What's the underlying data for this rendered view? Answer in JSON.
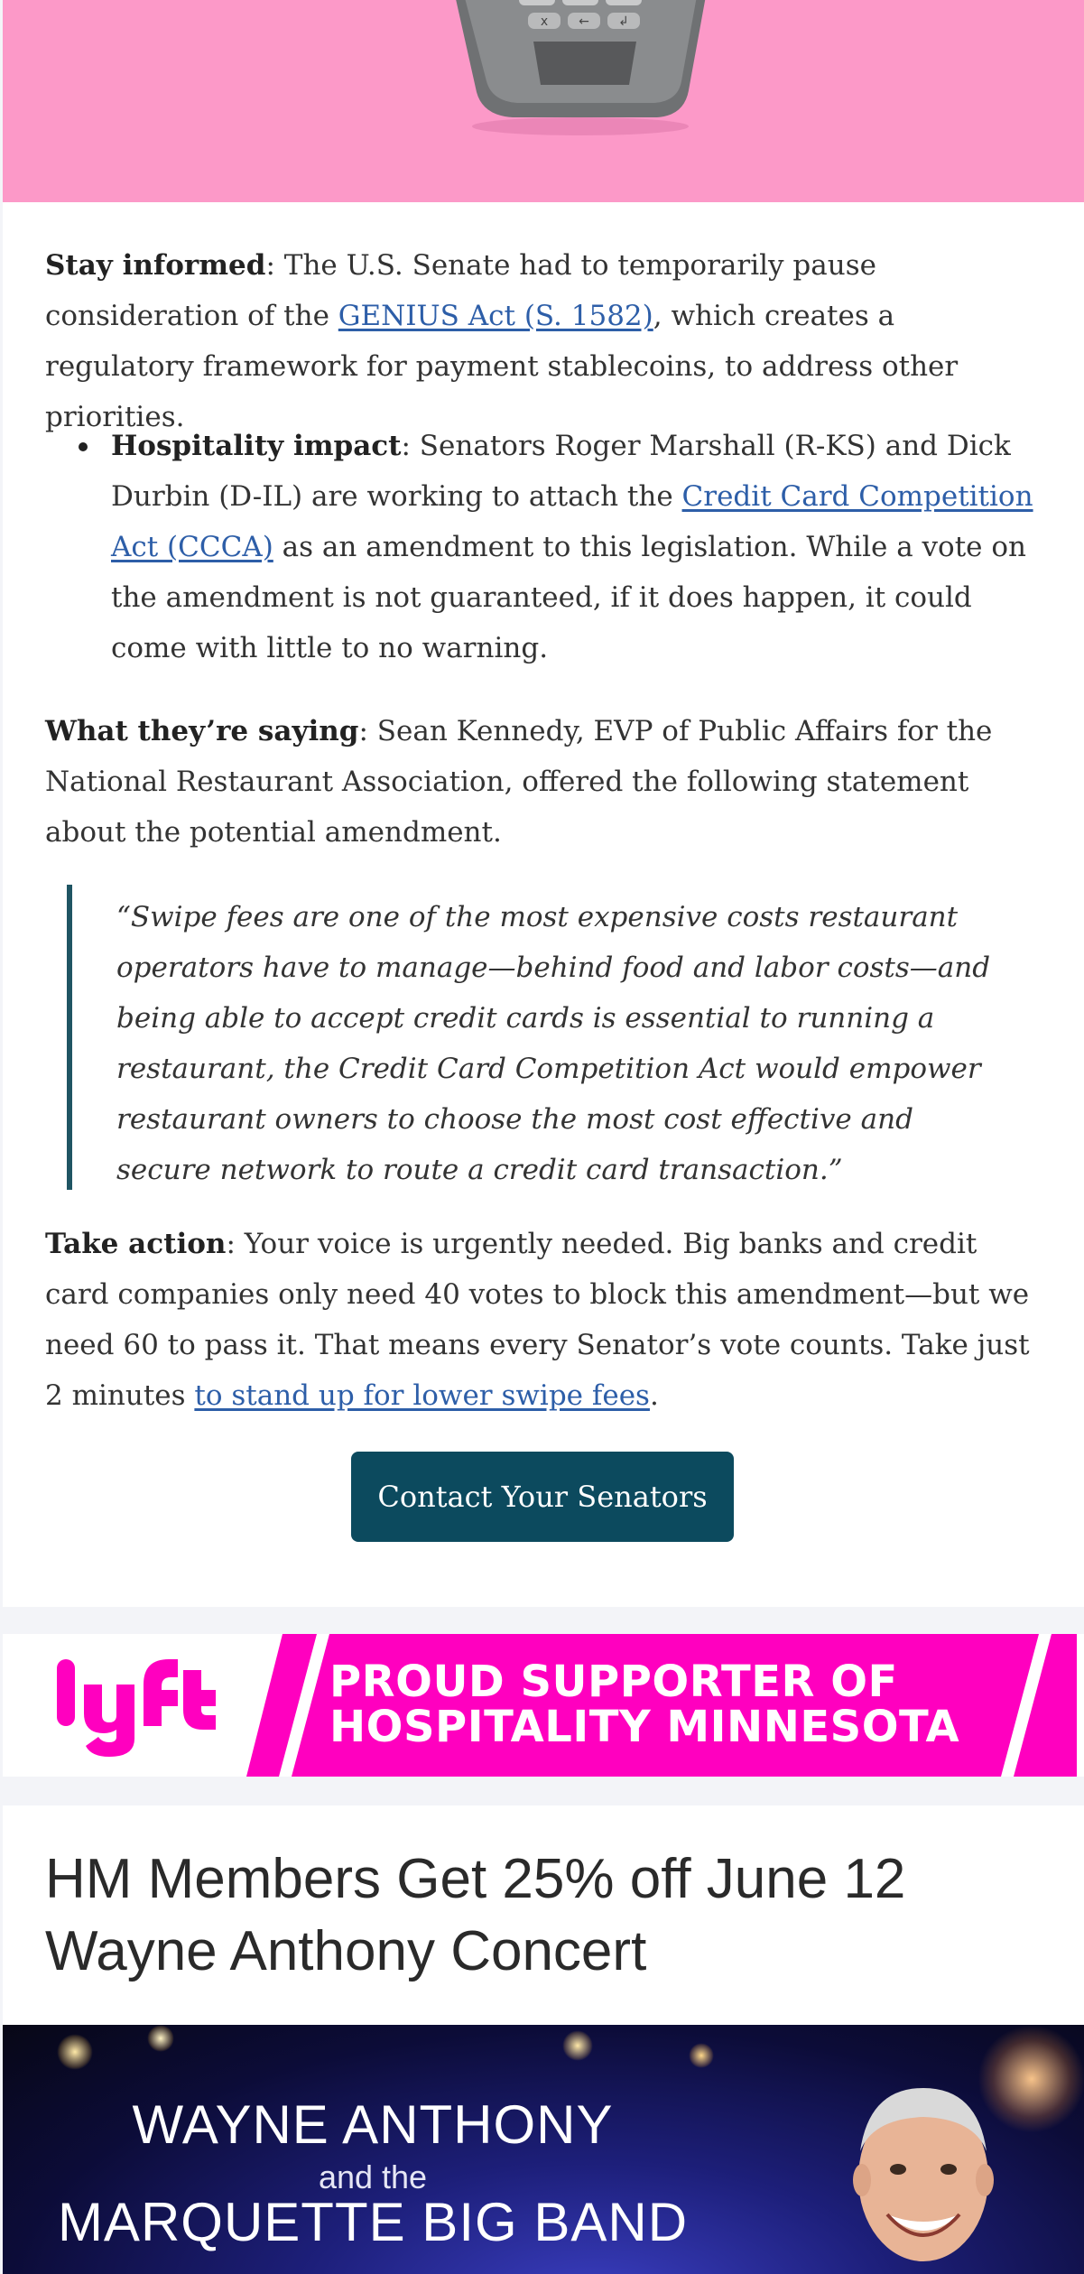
{
  "hero": {
    "image": "card-terminal-illustration",
    "bg_color": "#fc99c8"
  },
  "article": {
    "para1": {
      "lead": "Stay informed",
      "text_before_link": ": The U.S. Senate had to temporarily pause consideration of the ",
      "link": "GENIUS Act (S. 1582)",
      "text_after_link": ", which creates a regulatory framework for payment stablecoins, to address other priorities."
    },
    "bullet": {
      "lead": "Hospitality impact",
      "text_before_link": ": Senators Roger Marshall (R-KS) and Dick Durbin (D-IL) are working to attach the ",
      "link": "Credit Card Competition Act (CCCA)",
      "text_after_link": " as an amendment to this legislation. While a vote on the amendment is not guaranteed, if it does happen, it could come with little to no warning."
    },
    "para2": {
      "lead": "What they’re saying",
      "text": ": Sean Kennedy, EVP of Public Affairs for the National Restaurant Association, offered the following statement about the potential amendment."
    },
    "quote": "“Swipe fees are one of the most expensive costs restaurant operators have to manage—behind food and labor costs—and being able to accept credit cards is essential to running a restaurant, the Credit Card Competition Act would empower restaurant owners to choose the most cost effective and secure network to route a credit card transaction.”",
    "para3": {
      "lead": "Take action",
      "text_before_link": ": Your voice is urgently needed. Big banks and credit card companies only need 40 votes to block this amendment—but we need 60 to pass it. That means every Senator’s vote counts. Take just 2 minutes ",
      "link": "to stand up for lower swipe fees",
      "text_after_link": "."
    },
    "cta_label": "Contact Your Senators",
    "link_color": "#2d5ea8",
    "cta_color": "#0c4a5e",
    "quote_border_color": "#1f5563"
  },
  "sponsor": {
    "logo": "lyft",
    "line1": "PROUD SUPPORTER OF",
    "line2": "HOSPITALITY MINNESOTA",
    "brand_color": "#ff00bf"
  },
  "event": {
    "title_line1": "HM Members Get 25% off June 12",
    "title_line2": "Wayne Anthony Concert",
    "poster": {
      "line1": "WAYNE ANTHONY",
      "line2": "and the",
      "line3": "MARQUETTE BIG BAND"
    }
  }
}
